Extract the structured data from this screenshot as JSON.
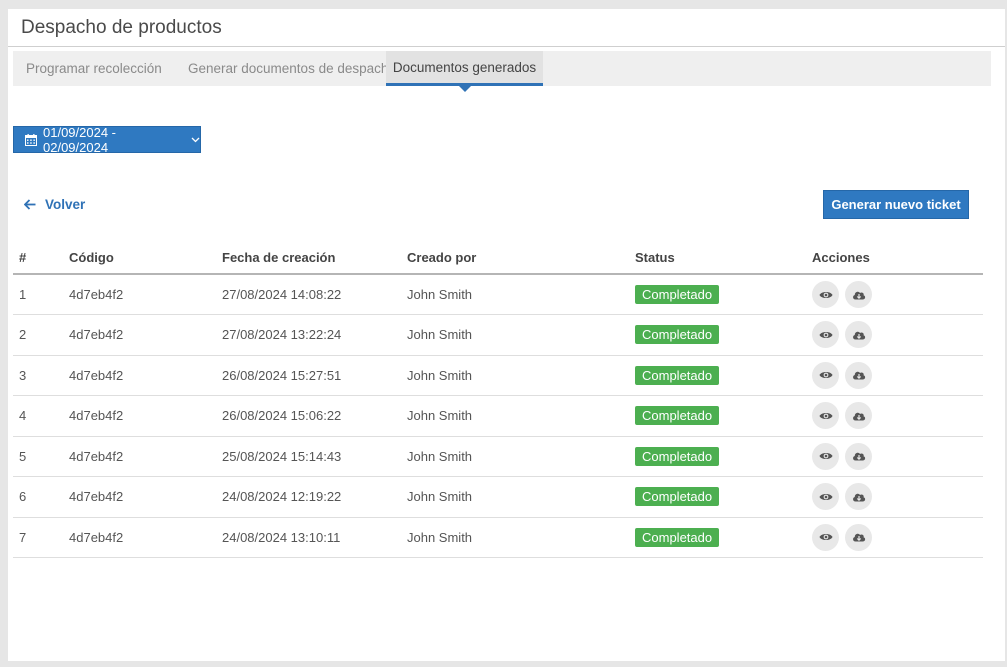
{
  "header": {
    "title": "Despacho de productos"
  },
  "tabs": [
    {
      "label": "Programar recolección"
    },
    {
      "label": "Generar documentos de despacho"
    },
    {
      "label": "Documentos generados"
    }
  ],
  "filters": {
    "date_range": "01/09/2024 - 02/09/2024"
  },
  "actions": {
    "back_label": "Volver",
    "new_ticket_label": "Generar nuevo ticket"
  },
  "table": {
    "columns": [
      "#",
      "Código",
      "Fecha de creación",
      "Creado por",
      "Status",
      "Acciones"
    ],
    "rows": [
      {
        "num": "1",
        "code": "4d7eb4f2",
        "date": "27/08/2024 14:08:22",
        "by": "John Smith",
        "status": "Completado"
      },
      {
        "num": "2",
        "code": "4d7eb4f2",
        "date": "27/08/2024 13:22:24",
        "by": "John Smith",
        "status": "Completado"
      },
      {
        "num": "3",
        "code": "4d7eb4f2",
        "date": "26/08/2024 15:27:51",
        "by": "John Smith",
        "status": "Completado"
      },
      {
        "num": "4",
        "code": "4d7eb4f2",
        "date": "26/08/2024 15:06:22",
        "by": "John Smith",
        "status": "Completado"
      },
      {
        "num": "5",
        "code": "4d7eb4f2",
        "date": "25/08/2024 15:14:43",
        "by": "John Smith",
        "status": "Completado"
      },
      {
        "num": "6",
        "code": "4d7eb4f2",
        "date": "24/08/2024 12:19:22",
        "by": "John Smith",
        "status": "Completado"
      },
      {
        "num": "7",
        "code": "4d7eb4f2",
        "date": "24/08/2024 13:10:11",
        "by": "John Smith",
        "status": "Completado"
      }
    ]
  },
  "icons": {
    "calendar": "calendar-icon",
    "chevron": "chevron-down-icon",
    "back": "arrow-left-icon",
    "view": "eye-icon",
    "download": "cloud-download-icon"
  },
  "colors": {
    "accent": "#2f79c1",
    "status_completed": "#4caf50"
  }
}
